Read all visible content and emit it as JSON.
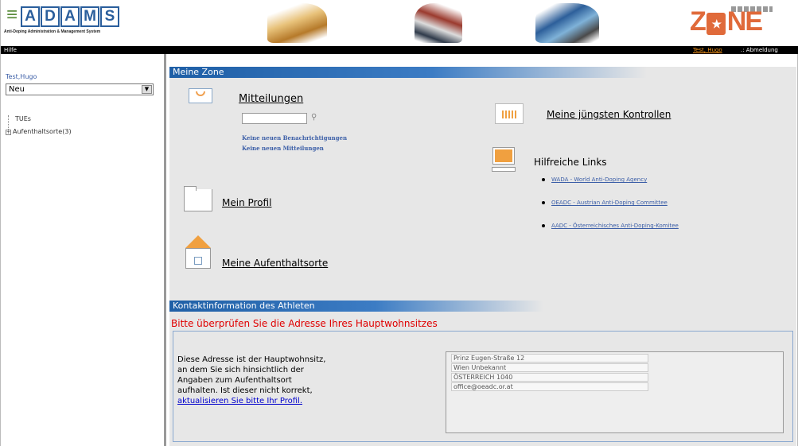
{
  "header": {
    "logo_letters": [
      "A",
      "D",
      "A",
      "M",
      "S"
    ],
    "logo_subtitle": "Anti-Doping Administration & Management System",
    "zone_logo": {
      "left": "Z",
      "right": "NE"
    },
    "colors": {
      "brand_blue": "#2a5e9c",
      "brand_green": "#5b8d3c",
      "zone_orange": "#e06a3a"
    }
  },
  "menubar": {
    "help": "Hilfe",
    "user": "Test, Hugo",
    "logout": ".: Abmeldung"
  },
  "sidebar": {
    "user": "Test,Hugo",
    "select_value": "Neu",
    "tree": [
      {
        "label": "TUEs"
      },
      {
        "label": "Aufenthaltsorte(3)"
      }
    ]
  },
  "main": {
    "section1_title": "Meine Zone",
    "messages": {
      "title": "Mitteilungen",
      "notice1": "Keine neuen Benachrichtigungen",
      "notice2": "Keine neuen Mitteilungen"
    },
    "profile_label": "Mein Profil",
    "whereabouts_label": "Meine Aufenthaltsorte",
    "controls_label": "Meine jüngsten Kontrollen",
    "links_title": "Hilfreiche Links",
    "links": [
      {
        "label": "WADA - World Anti-Doping Agency"
      },
      {
        "label": "OEADC - Austrian Anti-Doping Committee"
      },
      {
        "label": "AADC - Österreichisches Anti-Doping-Komitee"
      }
    ],
    "section2_title": "Kontaktinformation des Athleten",
    "warning": "Bitte überprüfen Sie die Adresse Ihres Hauptwohnsitzes",
    "address_note": "Diese Adresse ist der Hauptwohnsitz, an dem Sie sich hinsichtlich der Angaben zum Aufenthaltsort aufhalten. Ist dieser nicht korrekt,",
    "address_link": "aktualisieren Sie bitte Ihr Profil.",
    "address_lines": [
      "Prinz Eugen-Straße 12",
      "Wien  Unbekannt",
      "ÖSTERREICH 1040",
      "office@oeadc.or.at"
    ]
  }
}
